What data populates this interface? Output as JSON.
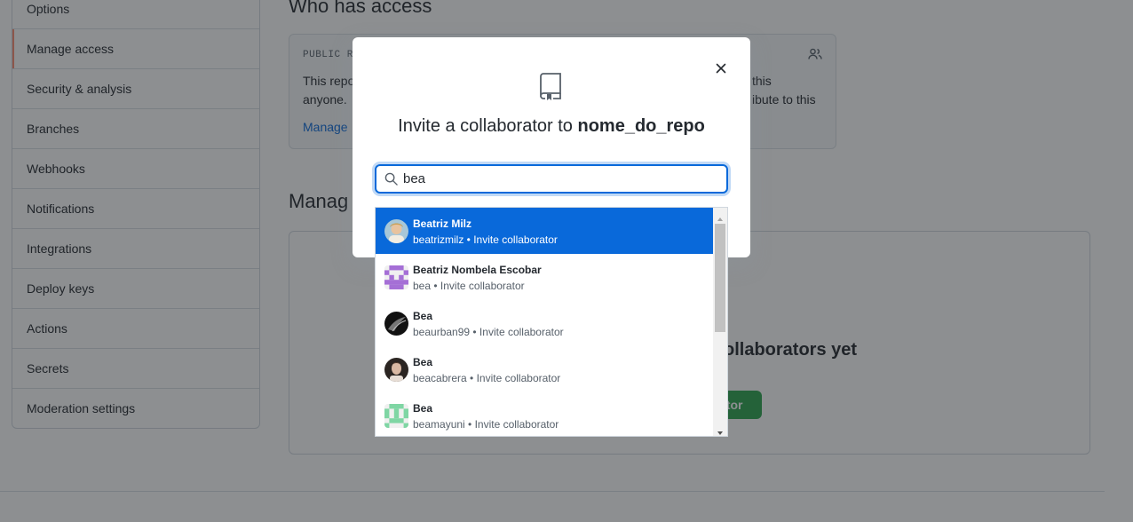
{
  "sidebar": {
    "items": [
      {
        "label": "Options"
      },
      {
        "label": "Manage access"
      },
      {
        "label": "Security & analysis"
      },
      {
        "label": "Branches"
      },
      {
        "label": "Webhooks"
      },
      {
        "label": "Notifications"
      },
      {
        "label": "Integrations"
      },
      {
        "label": "Deploy keys"
      },
      {
        "label": "Actions"
      },
      {
        "label": "Secrets"
      },
      {
        "label": "Moderation settings"
      }
    ],
    "selected": "Manage access"
  },
  "main": {
    "who_has_access_heading": "Who has access",
    "access_box": {
      "label": "PUBLIC RE",
      "text_line1_left": "This repo",
      "text_line1_right": "this",
      "text_line2_left": "anyone.",
      "text_line2_right": "ibute to this",
      "link": "Manage"
    },
    "manage_heading": "Manag",
    "empty_state_title": "ollaborators yet",
    "invite_button_label": "ator"
  },
  "dialog": {
    "title_prefix": "Invite a collaborator to",
    "repo_name": "nome_do_repo",
    "search": {
      "value": "bea"
    },
    "icons": {
      "close": "close-icon",
      "repo": "repo-icon",
      "search": "search-icon",
      "people": "people-icon"
    }
  },
  "suggestions": [
    {
      "name": "Beatriz Milz",
      "sub": "beatrizmilz • Invite collaborator",
      "active": true,
      "avatar": "photo"
    },
    {
      "name": "Beatriz Nombela Escobar",
      "sub": "bea • Invite collaborator",
      "active": false,
      "avatar": "identicon-purple"
    },
    {
      "name": "Bea",
      "sub": "beaurban99 • Invite collaborator",
      "active": false,
      "avatar": "photo-dark"
    },
    {
      "name": "Bea",
      "sub": "beacabrera • Invite collaborator",
      "active": false,
      "avatar": "photo-portrait"
    },
    {
      "name": "Bea",
      "sub": "beamayuni • Invite collaborator",
      "active": false,
      "avatar": "identicon-green"
    }
  ],
  "colors": {
    "accent": "#0969da",
    "selected_marker": "#fd8c73",
    "green_button": "#2da44e"
  }
}
